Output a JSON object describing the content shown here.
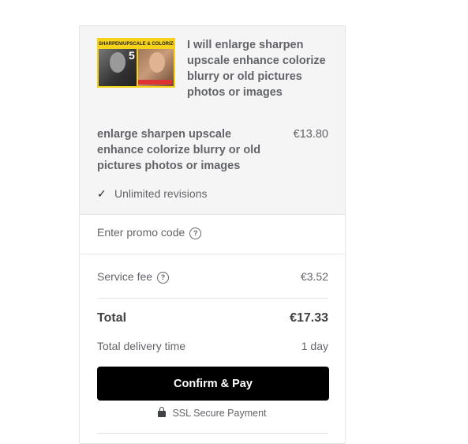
{
  "gig": {
    "thumbnail_banner": "SHARPEN/UPSCALE & COLORIZE",
    "thumbnail_number": "5",
    "title": "I will enlarge sharpen upscale enhance colorize blurry or old pictures photos or images"
  },
  "package": {
    "title": "enlarge sharpen upscale enhance colorize blurry or old pictures photos or images",
    "price": "€13.80",
    "feature": "Unlimited revisions"
  },
  "promo": {
    "label": "Enter promo code"
  },
  "summary": {
    "service_fee_label": "Service fee",
    "service_fee_value": "€3.52",
    "total_label": "Total",
    "total_value": "€17.33",
    "delivery_label": "Total delivery time",
    "delivery_value": "1 day"
  },
  "actions": {
    "confirm_label": "Confirm & Pay"
  },
  "security": {
    "ssl_label": "SSL Secure Payment"
  }
}
